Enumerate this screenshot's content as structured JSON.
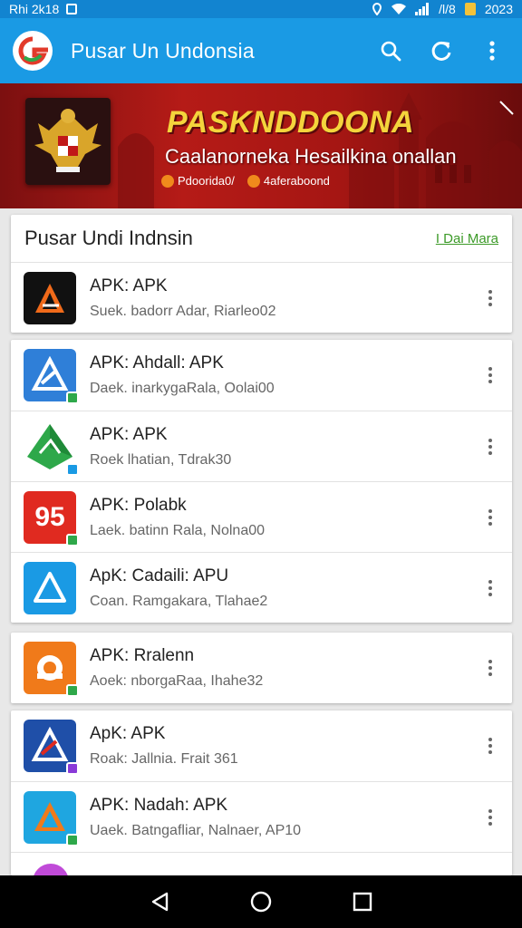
{
  "status_bar": {
    "left_text": "Rhi 2k18",
    "right_text": "/l/8",
    "time": "2023"
  },
  "app_bar": {
    "title": "Pusar Un Undonsia",
    "icons": [
      "app-logo-icon",
      "search-icon",
      "refresh-icon",
      "more-vert-icon"
    ]
  },
  "banner": {
    "title": "PASKNDDOONA",
    "subtitle": "Caalanorneka Hesailkina onallan",
    "tags": [
      "Pdoorida0/",
      "4aferaboond"
    ]
  },
  "section1": {
    "title": "Pusar Undi Indnsin",
    "link": "I Dai Mara",
    "items": [
      {
        "title": "APK: APK",
        "subtitle": "Suek. badorr Adar, Riarleo02",
        "icon_color": "#111111",
        "icon_name": "apk-app-icon"
      }
    ]
  },
  "section2": {
    "items": [
      {
        "title": "APK: Ahdall: APK",
        "subtitle": "Daek. inarkygaRala, Oolai00",
        "icon_color": "#2f7fd8",
        "icon_name": "apk-app-icon"
      },
      {
        "title": "APK: APK",
        "subtitle": "Roek lhatian, Tdrak30",
        "icon_color": "#2ea84a",
        "icon_name": "apk-app-icon"
      },
      {
        "title": "APK: Polabk",
        "subtitle": "Laek. batinn Rala, Nolna00",
        "icon_color": "#e02a20",
        "icon_label": "95",
        "icon_name": "apk-app-icon"
      },
      {
        "title": "ApK: Cadaili: APU",
        "subtitle": "Coan. Ramgakara, Tlahae2",
        "icon_color": "#1a9ae4",
        "icon_name": "apk-app-icon"
      }
    ]
  },
  "section3": {
    "items": [
      {
        "title": "APK: Rralenn",
        "subtitle": "Aoek: nborgaRaa, Ihahe32",
        "icon_color": "#f07a1a",
        "icon_name": "apk-app-icon"
      }
    ]
  },
  "section4": {
    "items": [
      {
        "title": "ApK: APK",
        "subtitle": "Roak: Jallnia. Frait 361",
        "icon_color": "#1f4fa8",
        "icon_name": "apk-app-icon"
      },
      {
        "title": "APK: Nadah: APK",
        "subtitle": "Uaek. Batngafliar, Nalnaer, AP10",
        "icon_color": "#1fa6e0",
        "icon_name": "apk-app-icon"
      }
    ]
  },
  "nav_bar": {
    "icons": [
      "back-icon",
      "home-icon",
      "recents-icon"
    ]
  },
  "colors": {
    "primary": "#1a9ae4",
    "status_bar": "#1284d0",
    "banner": "#b51b17",
    "link": "#3c9a28"
  }
}
